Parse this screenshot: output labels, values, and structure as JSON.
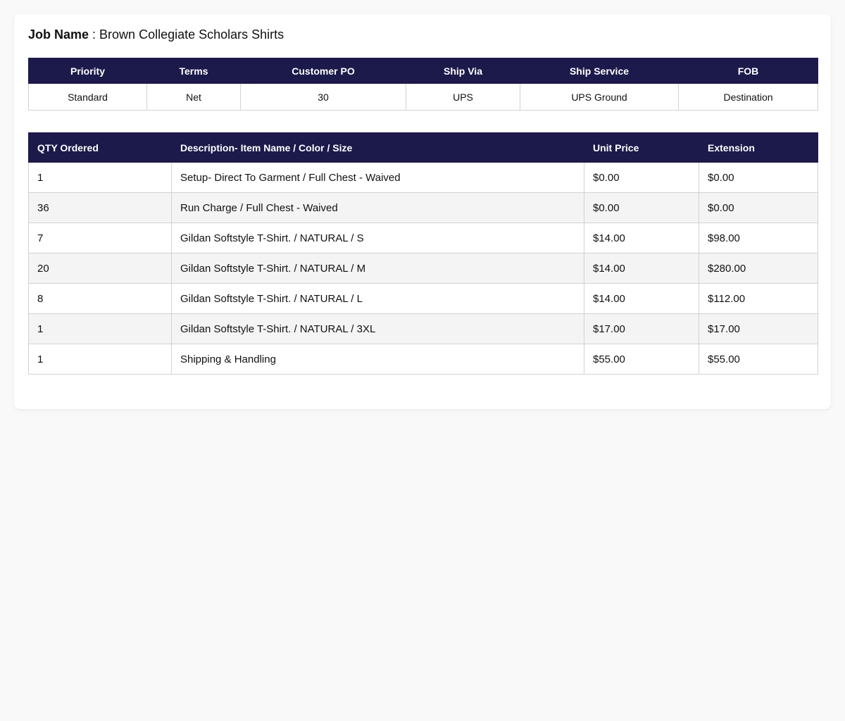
{
  "job": {
    "label": "Job Name",
    "separator": " : ",
    "value": "Brown Collegiate Scholars Shirts"
  },
  "order_info": {
    "headers": [
      "Priority",
      "Terms",
      "Customer PO",
      "Ship Via",
      "Ship Service",
      "FOB"
    ],
    "values": [
      "Standard",
      "Net",
      "30",
      "UPS",
      "UPS Ground",
      "Destination"
    ]
  },
  "line_items": {
    "headers": [
      "QTY Ordered",
      "Description- Item Name / Color / Size",
      "Unit Price",
      "Extension"
    ],
    "rows": [
      [
        "1",
        "Setup- Direct To Garment / Full Chest - Waived",
        "$0.00",
        "$0.00"
      ],
      [
        "36",
        "Run Charge / Full Chest - Waived",
        "$0.00",
        "$0.00"
      ],
      [
        "7",
        "Gildan Softstyle T-Shirt. / NATURAL / S",
        "$14.00",
        "$98.00"
      ],
      [
        "20",
        "Gildan Softstyle T-Shirt. / NATURAL / M",
        "$14.00",
        "$280.00"
      ],
      [
        "8",
        "Gildan Softstyle T-Shirt. / NATURAL / L",
        "$14.00",
        "$112.00"
      ],
      [
        "1",
        "Gildan Softstyle T-Shirt. / NATURAL / 3XL",
        "$17.00",
        "$17.00"
      ],
      [
        "1",
        "Shipping & Handling",
        "$55.00",
        "$55.00"
      ]
    ]
  },
  "colors": {
    "header_bg": "#1c1a4b",
    "header_text": "#ffffff",
    "row_alt_bg": "#f4f4f4",
    "page_bg": "#f9f9f9"
  }
}
